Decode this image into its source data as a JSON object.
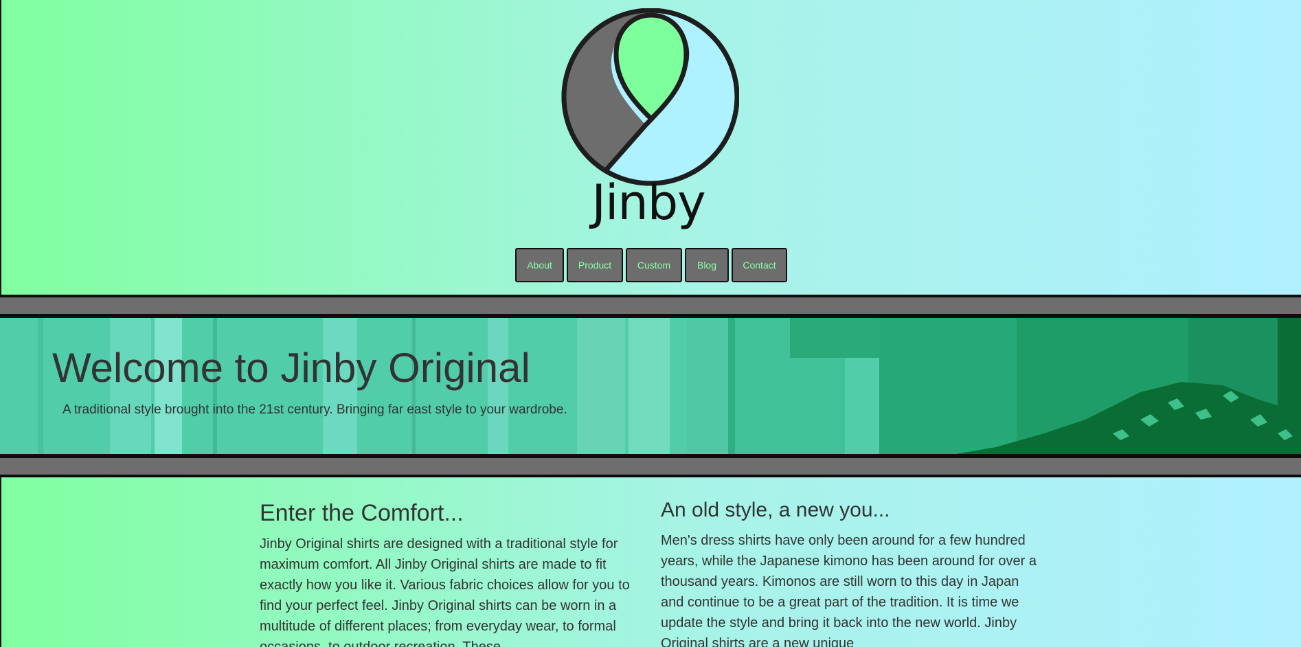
{
  "brand": {
    "name": "Jinby",
    "colors": {
      "green": "#7dff9c",
      "light_blue": "#aef2ff",
      "gray": "#6d6d6d",
      "outline": "#1e1e1e"
    }
  },
  "nav": {
    "items": [
      {
        "label": "About"
      },
      {
        "label": "Product"
      },
      {
        "label": "Custom"
      },
      {
        "label": "Blog"
      },
      {
        "label": "Contact"
      }
    ]
  },
  "hero": {
    "title": "Welcome to Jinby Original",
    "subtitle": "A traditional style brought into the 21st century. Bringing far east style to your wardrobe."
  },
  "sections": [
    {
      "heading": "Enter the Comfort...",
      "body": "Jinby Original shirts are designed with a traditional style for maximum comfort. All Jinby Original shirts are made to fit exactly how you like it. Various fabric choices allow for you to find your perfect feel. Jinby Original shirts can be worn in a multitude of different places; from everyday wear, to formal occasions, to outdoor recreation. These"
    },
    {
      "heading": "An old style, a new you...",
      "body": "Men's dress shirts have only been around for a few hundred years, while the Japanese kimono has been around for over a thousand years. Kimonos are still worn to this day in Japan and continue to be a great part of the tradition. It is time we update the style and bring it back into the new world. Jinby Original shirts are a new unique"
    }
  ]
}
